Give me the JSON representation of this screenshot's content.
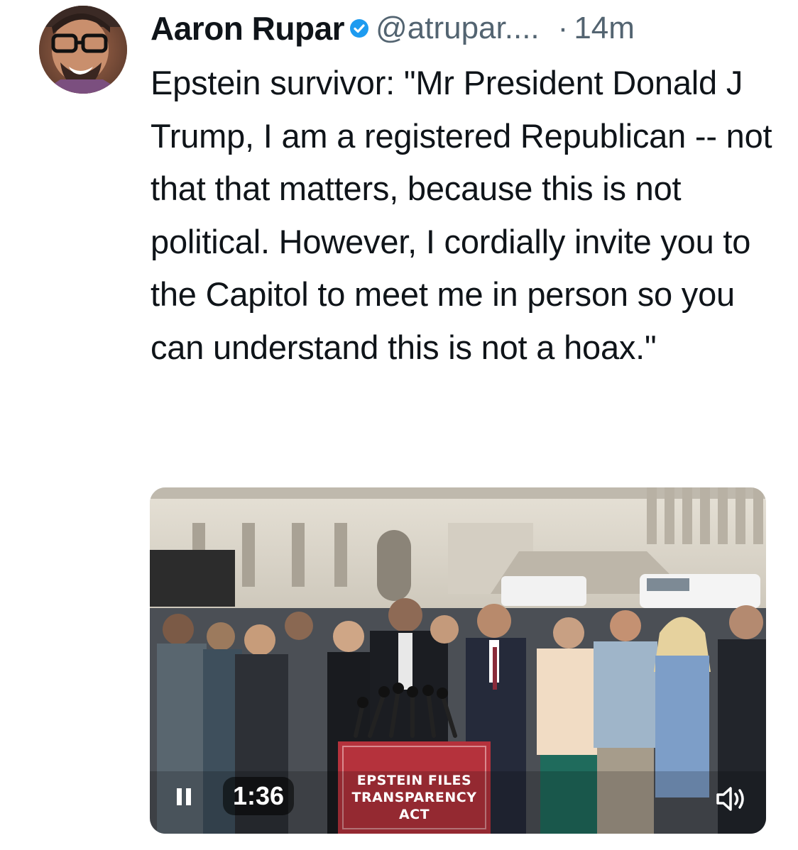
{
  "tweet": {
    "author_name": "Aaron Rupar",
    "handle": "@atrupar....",
    "separator": "·",
    "time": "14m",
    "verified_icon": "verified-badge-icon",
    "text": "Epstein survivor: \"Mr President Donald J Trump, I am a registered Republican -- not that that matters, because this is not political. However, I cordially invite you to the Capitol to meet me in person so you can understand this is not a hoax.\""
  },
  "video": {
    "elapsed": "1:36",
    "pause_icon": "pause-icon",
    "volume_icon": "volume-icon",
    "podium_sign_line1": "EPSTEIN FILES",
    "podium_sign_line2": "TRANSPARENCY ACT"
  },
  "colors": {
    "text_primary": "#0f1419",
    "text_secondary": "#536471",
    "verified_blue": "#1d9bf0",
    "podium_red": "#b5323c"
  }
}
